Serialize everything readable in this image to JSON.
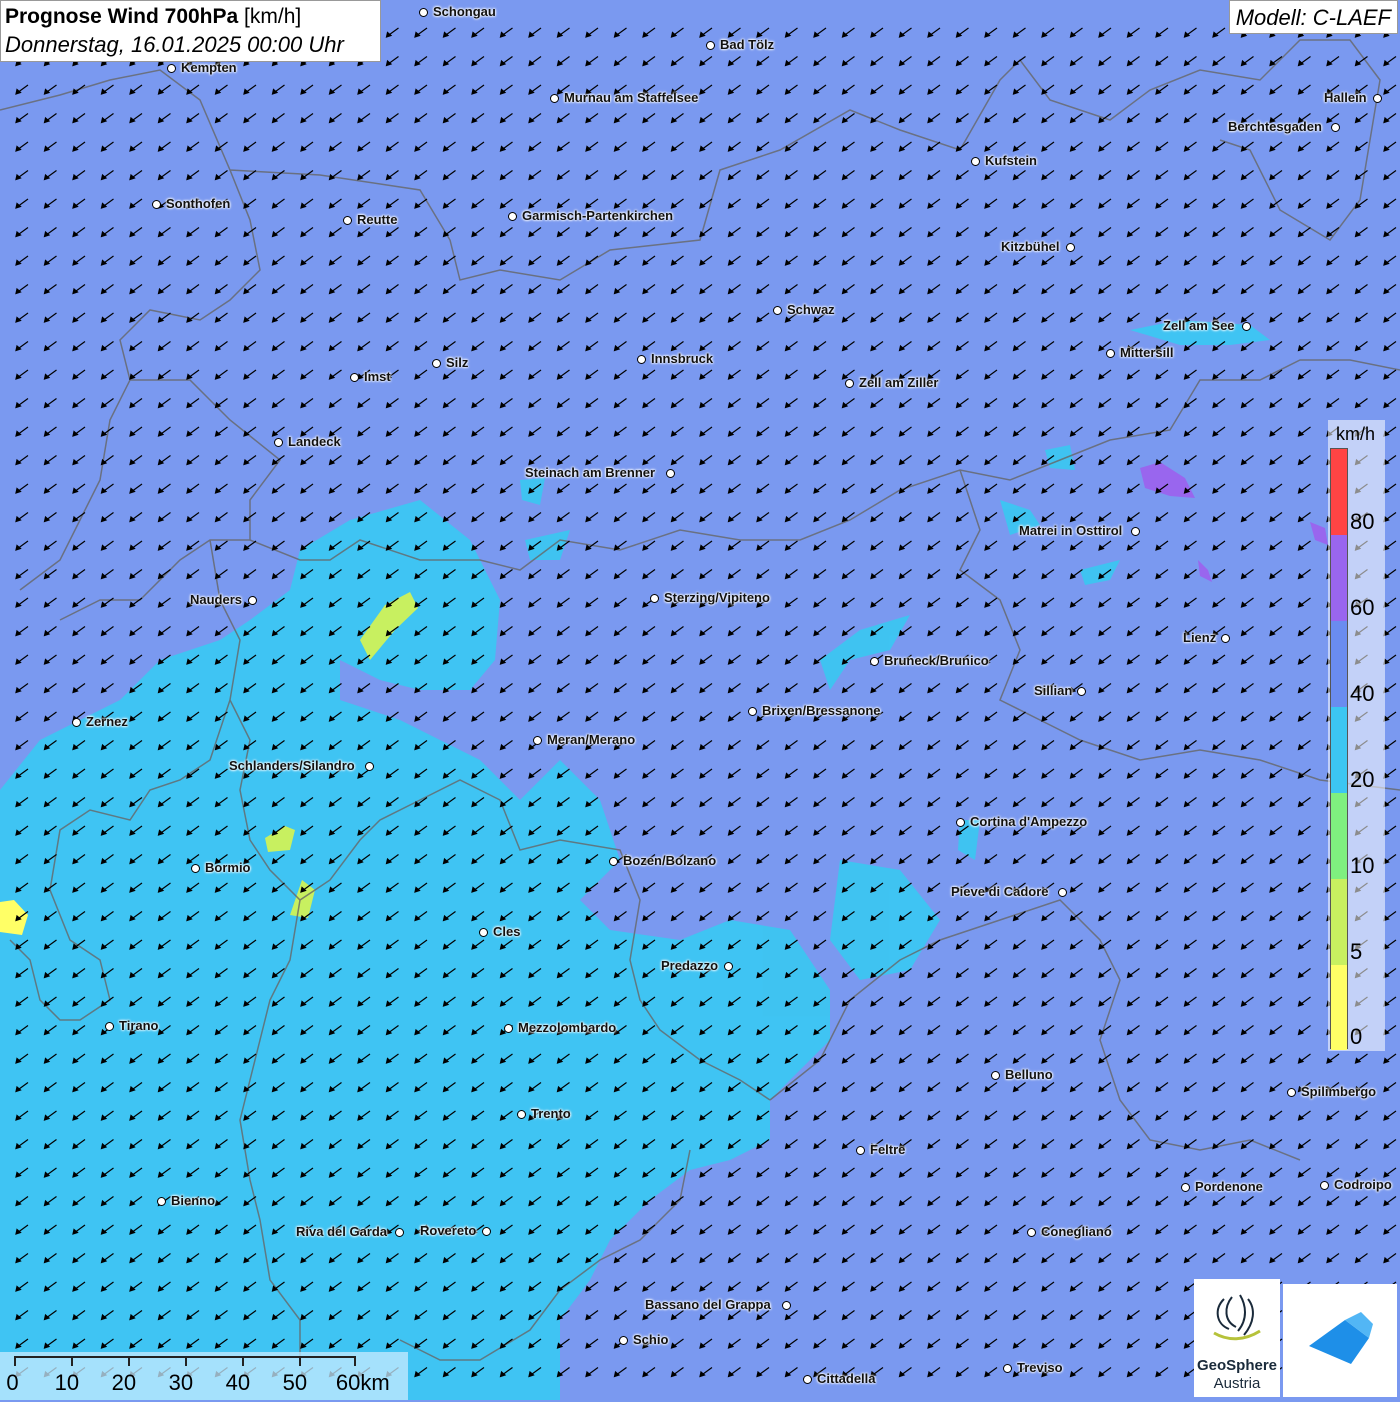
{
  "header": {
    "title_bold": "Prognose Wind 700hPa",
    "title_unit": "[km/h]",
    "date": "Donnerstag, 16.01.2025 00:00 Uhr",
    "model": "Modell: C-LAEF"
  },
  "colors": {
    "background": "#7a99f0",
    "band_20_40": "#3cc6f2",
    "band_10_20": "#7ff07f",
    "band_5_10": "#c8f060",
    "band_0_5": "#ffff66",
    "band_40_60": "#6a8cf0",
    "band_60_80": "#9966ee",
    "band_80plus": "#ff4444",
    "arrow": "#000000",
    "border": "#666666"
  },
  "cities": [
    {
      "name": "Schongau"
    },
    {
      "name": "Kempten"
    },
    {
      "name": "Bad Tölz"
    },
    {
      "name": "Murnau am Staffelsee"
    },
    {
      "name": "Hallein"
    },
    {
      "name": "Berchtesgaden"
    },
    {
      "name": "Kufstein"
    },
    {
      "name": "Sonthofen"
    },
    {
      "name": "Reutte"
    },
    {
      "name": "Garmisch-Partenkirchen"
    },
    {
      "name": "Kitzbühel"
    },
    {
      "name": "Schwaz"
    },
    {
      "name": "Zell am See"
    },
    {
      "name": "Mittersill"
    },
    {
      "name": "Innsbruck"
    },
    {
      "name": "Silz"
    },
    {
      "name": "Imst"
    },
    {
      "name": "Zell am Ziller"
    },
    {
      "name": "Landeck"
    },
    {
      "name": "Steinach am Brenner"
    },
    {
      "name": "Matrei in Osttirol"
    },
    {
      "name": "Nauders"
    },
    {
      "name": "Sterzing/Vipiteno"
    },
    {
      "name": "Lienz"
    },
    {
      "name": "Bruneck/Brunico"
    },
    {
      "name": "Sillian"
    },
    {
      "name": "Zernez"
    },
    {
      "name": "Brixen/Bressanone"
    },
    {
      "name": "Meran/Merano"
    },
    {
      "name": "Schlanders/Silandro"
    },
    {
      "name": "Cortina d'Ampezzo"
    },
    {
      "name": "Bozen/Bolzano"
    },
    {
      "name": "Bormio"
    },
    {
      "name": "Pieve di Cadore"
    },
    {
      "name": "Cles"
    },
    {
      "name": "Predazzo"
    },
    {
      "name": "Tirano"
    },
    {
      "name": "Mezzolombardo"
    },
    {
      "name": "Belluno"
    },
    {
      "name": "Spilimbergo"
    },
    {
      "name": "Trento"
    },
    {
      "name": "Feltre"
    },
    {
      "name": "Pordenone"
    },
    {
      "name": "Codroipo"
    },
    {
      "name": "Bienno"
    },
    {
      "name": "Riva del Garda"
    },
    {
      "name": "Rovereto"
    },
    {
      "name": "Conegliano"
    },
    {
      "name": "Bassano del Grappa"
    },
    {
      "name": "Schio"
    },
    {
      "name": "Treviso"
    },
    {
      "name": "Cittadella"
    }
  ],
  "legend": {
    "unit": "km/h",
    "ticks": [
      "80",
      "60",
      "40",
      "20",
      "10",
      "5",
      "0"
    ]
  },
  "scale": {
    "labels": [
      "0",
      "10",
      "20",
      "30",
      "40",
      "50",
      "60km"
    ]
  },
  "logos": {
    "geosphere_line1": "GeoSphere",
    "geosphere_line2": "Austria"
  },
  "wind": {
    "direction": "north-east to south-west"
  }
}
